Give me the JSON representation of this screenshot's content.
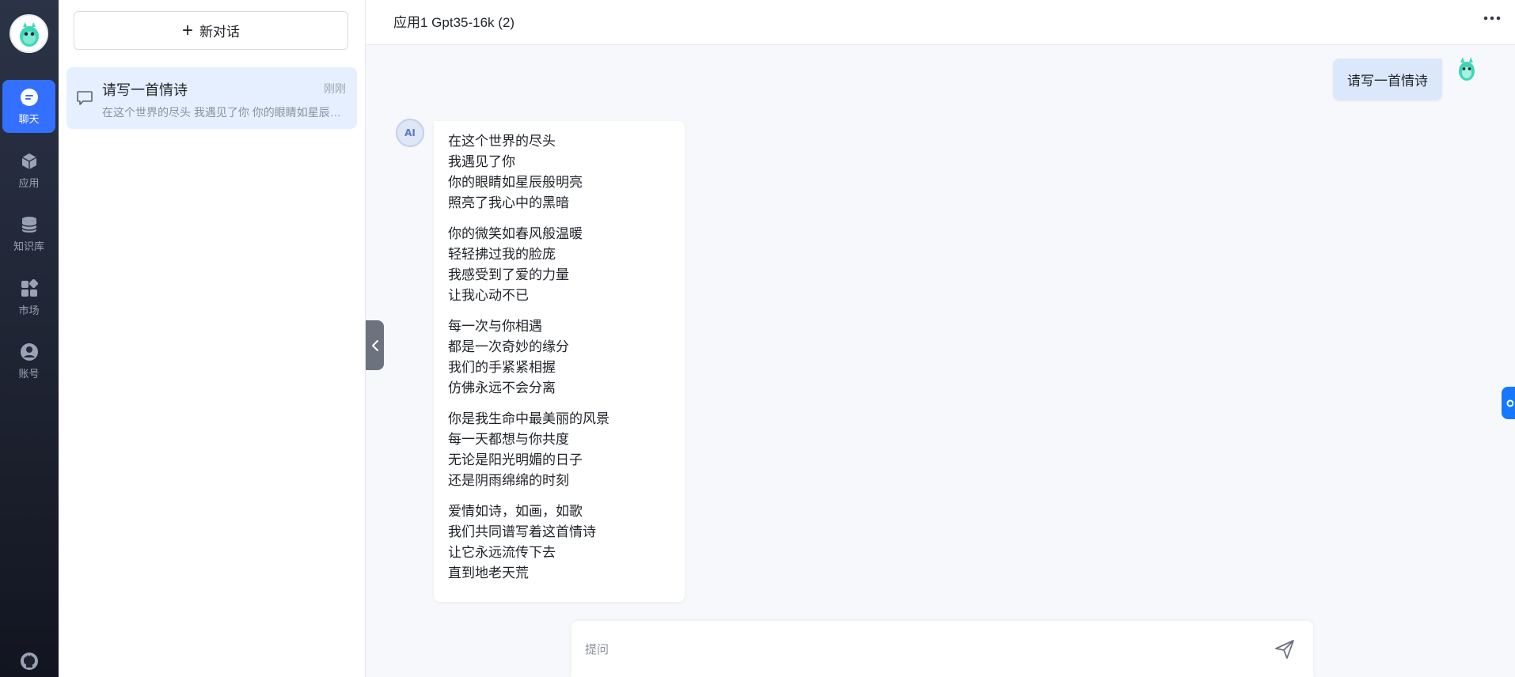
{
  "nav": {
    "items": [
      {
        "label": "聊天",
        "icon": "chat-icon",
        "active": true
      },
      {
        "label": "应用",
        "icon": "cube-icon",
        "active": false
      },
      {
        "label": "知识库",
        "icon": "database-icon",
        "active": false
      },
      {
        "label": "市场",
        "icon": "grid-icon",
        "active": false
      },
      {
        "label": "账号",
        "icon": "user-icon",
        "active": false
      }
    ],
    "accent_color": "#3370ff"
  },
  "history": {
    "new_chat_label": "新对话",
    "items": [
      {
        "title": "请写一首情诗",
        "time": "刚刚",
        "preview": "在这个世界的尽头 我遇见了你 你的眼睛如星辰般明亮 照亮了我心中的黑暗"
      }
    ]
  },
  "header": {
    "title": "应用1 Gpt35-16k (2)"
  },
  "chat": {
    "user_message": "请写一首情诗",
    "ai_stanzas": [
      [
        "在这个世界的尽头",
        "我遇见了你",
        "你的眼睛如星辰般明亮",
        "照亮了我心中的黑暗"
      ],
      [
        "你的微笑如春风般温暖",
        "轻轻拂过我的脸庞",
        "我感受到了爱的力量",
        "让我心动不已"
      ],
      [
        "每一次与你相遇",
        "都是一次奇妙的缘分",
        "我们的手紧紧相握",
        "仿佛永远不会分离"
      ],
      [
        "你是我生命中最美丽的风景",
        "每一天都想与你共度",
        "无论是阳光明媚的日子",
        "还是阴雨绵绵的时刻"
      ],
      [
        "爱情如诗，如画，如歌",
        "我们共同谱写着这首情诗",
        "让它永远流传下去",
        "直到地老天荒"
      ]
    ]
  },
  "input": {
    "placeholder": "提问",
    "value": ""
  }
}
